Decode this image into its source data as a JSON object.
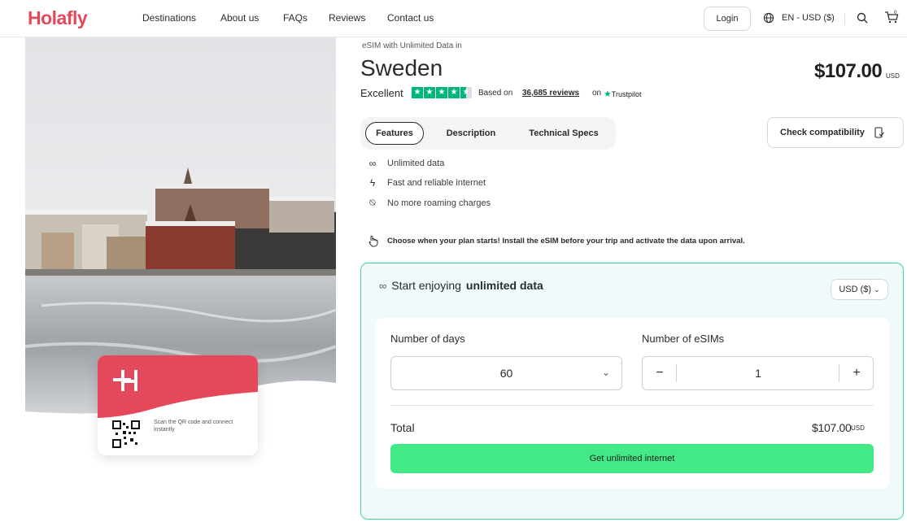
{
  "header": {
    "logo": "Holafly",
    "nav": [
      "Destinations",
      "About us",
      "FAQs",
      "Reviews",
      "Contact us"
    ],
    "login_label": "Login",
    "language_currency": "EN - USD ($)",
    "cart_count": "0"
  },
  "hero": {
    "card_text": "Scan the QR code and connect instantly"
  },
  "product": {
    "eyebrow": "eSIM with Unlimited Data in",
    "title": "Sweden",
    "price": "$107.00",
    "price_currency": "USD",
    "rating_label": "Excellent",
    "stars": 4.5,
    "based_on": "Based on",
    "reviews_count": "36,685 reviews",
    "on_label": "on",
    "trustpilot": "Trustpilot"
  },
  "tabs": [
    "Features",
    "Description",
    "Technical Specs"
  ],
  "check_compatibility": "Check compatibility",
  "features": [
    "Unlimited data",
    "Fast and reliable internet",
    "No more roaming charges"
  ],
  "plan_note": "Choose when your plan starts! Install the eSIM before your trip and activate the data upon arrival.",
  "purchase": {
    "heading_prefix": "Start enjoying",
    "heading_bold": "unlimited data",
    "currency_select": "USD ($)",
    "days_label": "Number of days",
    "days_value": "60",
    "esims_label": "Number of eSIMs",
    "esims_value": "1",
    "minus": "−",
    "plus": "+",
    "total_label": "Total",
    "total_value": "$107.00",
    "total_currency": "USD",
    "cta": "Get unlimited internet"
  },
  "colors": {
    "brand": "#e6485b",
    "cta": "#44e987",
    "trustpilot": "#00b67a",
    "box_border": "#3fd88d"
  }
}
